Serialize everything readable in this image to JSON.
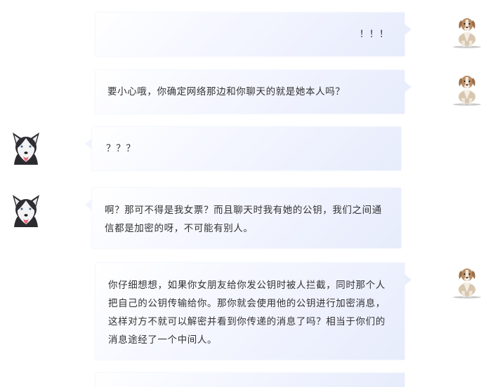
{
  "messages": [
    {
      "sender": "puppy",
      "side": "right",
      "text": "！！！"
    },
    {
      "sender": "puppy",
      "side": "right",
      "text": "要小心哦，你确定网络那边和你聊天的就是她本人吗？"
    },
    {
      "sender": "husky",
      "side": "left",
      "text": "？？？"
    },
    {
      "sender": "husky",
      "side": "left",
      "text": "啊？那可不得是我女票？而且聊天时我有她的公钥，我们之间通信都是加密的呀，不可能有别人。"
    },
    {
      "sender": "puppy",
      "side": "right",
      "text": "你仔细想想，如果你女朋友给你发公钥时被人拦截，同时那个人把自己的公钥传输给你。那你就会使用他的公钥进行加密消息，这样对方不就可以解密并看到你传递的消息了吗？相当于你们的消息途经了一个中间人。"
    }
  ],
  "avatars": {
    "puppy": "puppy-dog-avatar",
    "husky": "husky-dog-avatar"
  }
}
